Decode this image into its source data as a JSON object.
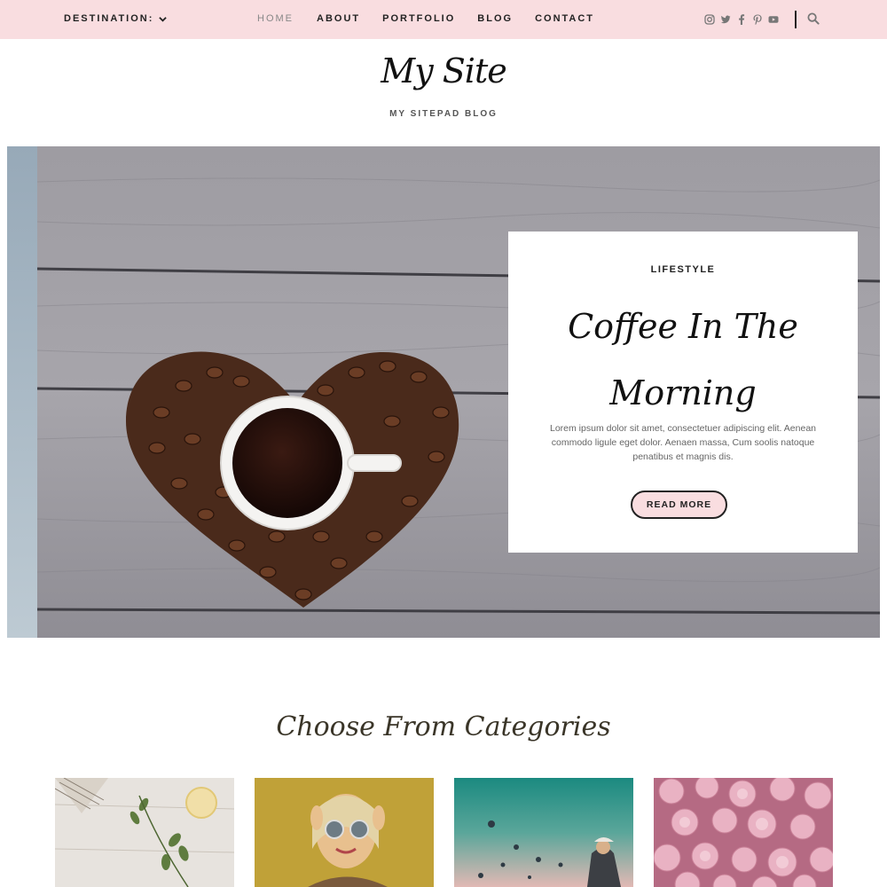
{
  "topbar": {
    "destination_label": "DESTINATION:",
    "nav": [
      {
        "label": "HOME",
        "active": true
      },
      {
        "label": "ABOUT",
        "active": false
      },
      {
        "label": "PORTFOLIO",
        "active": false
      },
      {
        "label": "BLOG",
        "active": false
      },
      {
        "label": "CONTACT",
        "active": false
      }
    ],
    "social_icons": [
      "instagram-icon",
      "twitter-icon",
      "facebook-icon",
      "pinterest-icon",
      "youtube-icon"
    ],
    "search_icon": "search-icon"
  },
  "header": {
    "site_title": "My Site",
    "tagline": "MY SITEPAD BLOG"
  },
  "hero": {
    "category": "LIFESTYLE",
    "title_line1": "Coffee In The",
    "title_line2": "Morning",
    "excerpt": "Lorem ipsum dolor sit amet, consectetuer adipiscing elit. Aenean commodo ligule eget dolor. Aenaen massa, Cum soolis natoque penatibus et magnis dis.",
    "button_label": "READ MORE"
  },
  "categories": {
    "heading": "Choose From Categories"
  },
  "colors": {
    "topbar_bg": "#f9dde0",
    "button_bg": "#f9dde0",
    "text_dark": "#222222"
  }
}
